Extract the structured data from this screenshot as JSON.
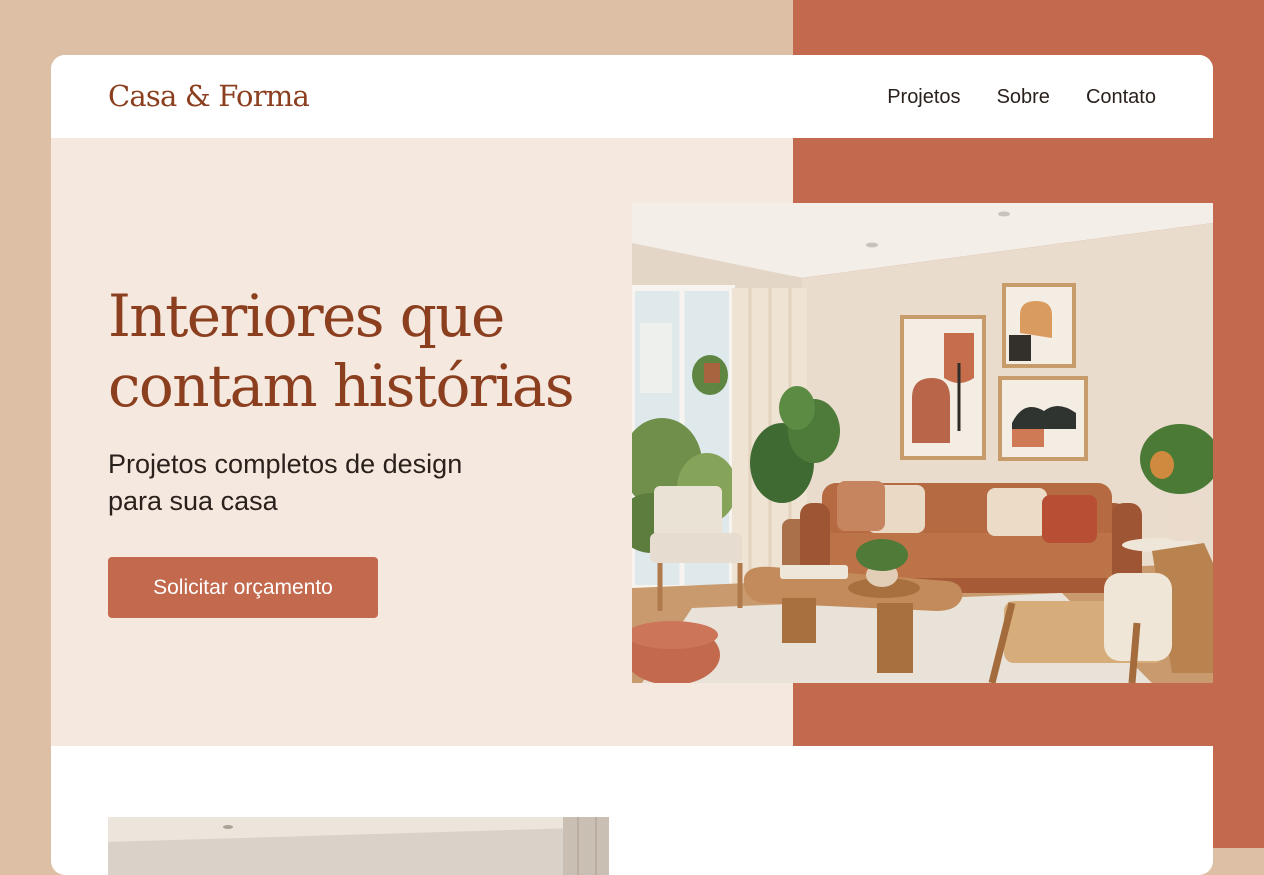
{
  "brand": {
    "name": "Casa & Forma"
  },
  "nav": {
    "items": [
      "Projetos",
      "Sobre",
      "Contato"
    ]
  },
  "hero": {
    "title_line1": "Interiores que",
    "title_line2": "contam histórias",
    "subtitle_line1": "Projetos completos de design",
    "subtitle_line2": "para sua casa",
    "cta_label": "Solicitar orçamento"
  },
  "colors": {
    "accent": "#c2694e",
    "brand_text": "#8b3f1f",
    "hero_bg": "#f4e8df",
    "page_bg": "#dcbfa4"
  }
}
